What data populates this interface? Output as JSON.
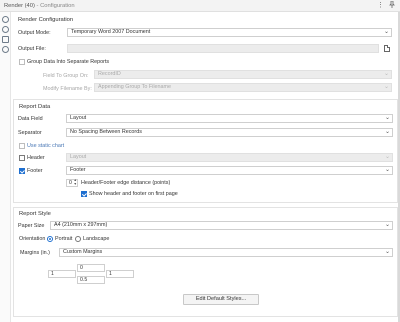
{
  "window": {
    "tool_name": "Render (40)",
    "separator": " - ",
    "panel_name": "Configuration",
    "more_icon": "⋮",
    "pin_icon": "pin-icon"
  },
  "render_config": {
    "title": "Render Configuration",
    "output_mode_label": "Output Mode:",
    "output_mode_value": "Temporary Word 2007 Document",
    "output_file_label": "Output File:",
    "output_file_value": "",
    "group_label": "Group Data Into Separate Reports",
    "field_to_group_label": "Field To Group On:",
    "field_to_group_value": "RecordID",
    "modify_filename_label": "Modify Filename By:",
    "modify_filename_value": "Appending Group To Filename"
  },
  "report_data": {
    "title": "Report Data",
    "data_field_label": "Data Field",
    "data_field_value": "Layout",
    "separator_label": "Separator",
    "separator_value": "No Spacing Between Records",
    "static_chart_label": "Use static chart",
    "header_label": "Header",
    "header_value": "Layout",
    "footer_label": "Footer",
    "footer_value": "Footer",
    "edge_distance_value": "0",
    "edge_distance_label": "Header/Footer edge distance (points)",
    "show_first_page_label": "Show header and footer on first page"
  },
  "report_style": {
    "title": "Report Style",
    "paper_size_label": "Paper Size",
    "paper_size_value": "A4 (210mm x 297mm)",
    "orientation_label": "Orientation",
    "portrait_label": "Portrait",
    "landscape_label": "Landscape",
    "margins_label": "Margins (in.)",
    "margins_value": "Custom Margins",
    "margin_top": "0",
    "margin_left": "1",
    "margin_right": "1",
    "margin_bottom": "0.5",
    "edit_styles_label": "Edit Default Styles..."
  },
  "sidebar_icons": [
    "gear-icon",
    "circle-x-icon",
    "tag-icon",
    "help-icon"
  ]
}
